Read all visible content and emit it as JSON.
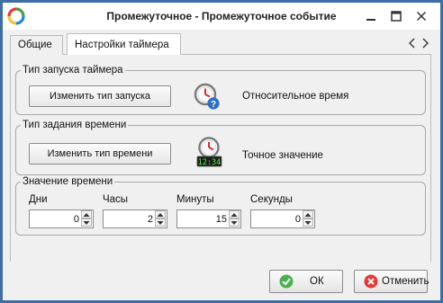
{
  "window": {
    "title": "Промежуточное - Промежуточное событие",
    "brand_colors": [
      "#e53935",
      "#43a047",
      "#1e88e5",
      "#fbc02d"
    ]
  },
  "tabs": [
    {
      "label": "Общие",
      "active": false
    },
    {
      "label": "Настройки таймера",
      "active": true
    }
  ],
  "trigger_group": {
    "legend": "Тип запуска таймера",
    "button_label": "Изменить тип запуска",
    "icon": "clock-question-icon",
    "value": "Относительное время"
  },
  "time_type_group": {
    "legend": "Тип задания времени",
    "button_label": "Изменить тип времени",
    "icon": "clock-digital-icon",
    "digital_display": "12:34",
    "value": "Точное значение"
  },
  "time_value_group": {
    "legend": "Значение времени",
    "fields": [
      {
        "label": "Дни",
        "value": "0"
      },
      {
        "label": "Часы",
        "value": "2"
      },
      {
        "label": "Минуты",
        "value": "15"
      },
      {
        "label": "Секунды",
        "value": "0"
      }
    ]
  },
  "footer": {
    "ok_label": "ОК",
    "cancel_label": "Отменить",
    "ok_color": "#4caf50",
    "cancel_color": "#e53935"
  }
}
